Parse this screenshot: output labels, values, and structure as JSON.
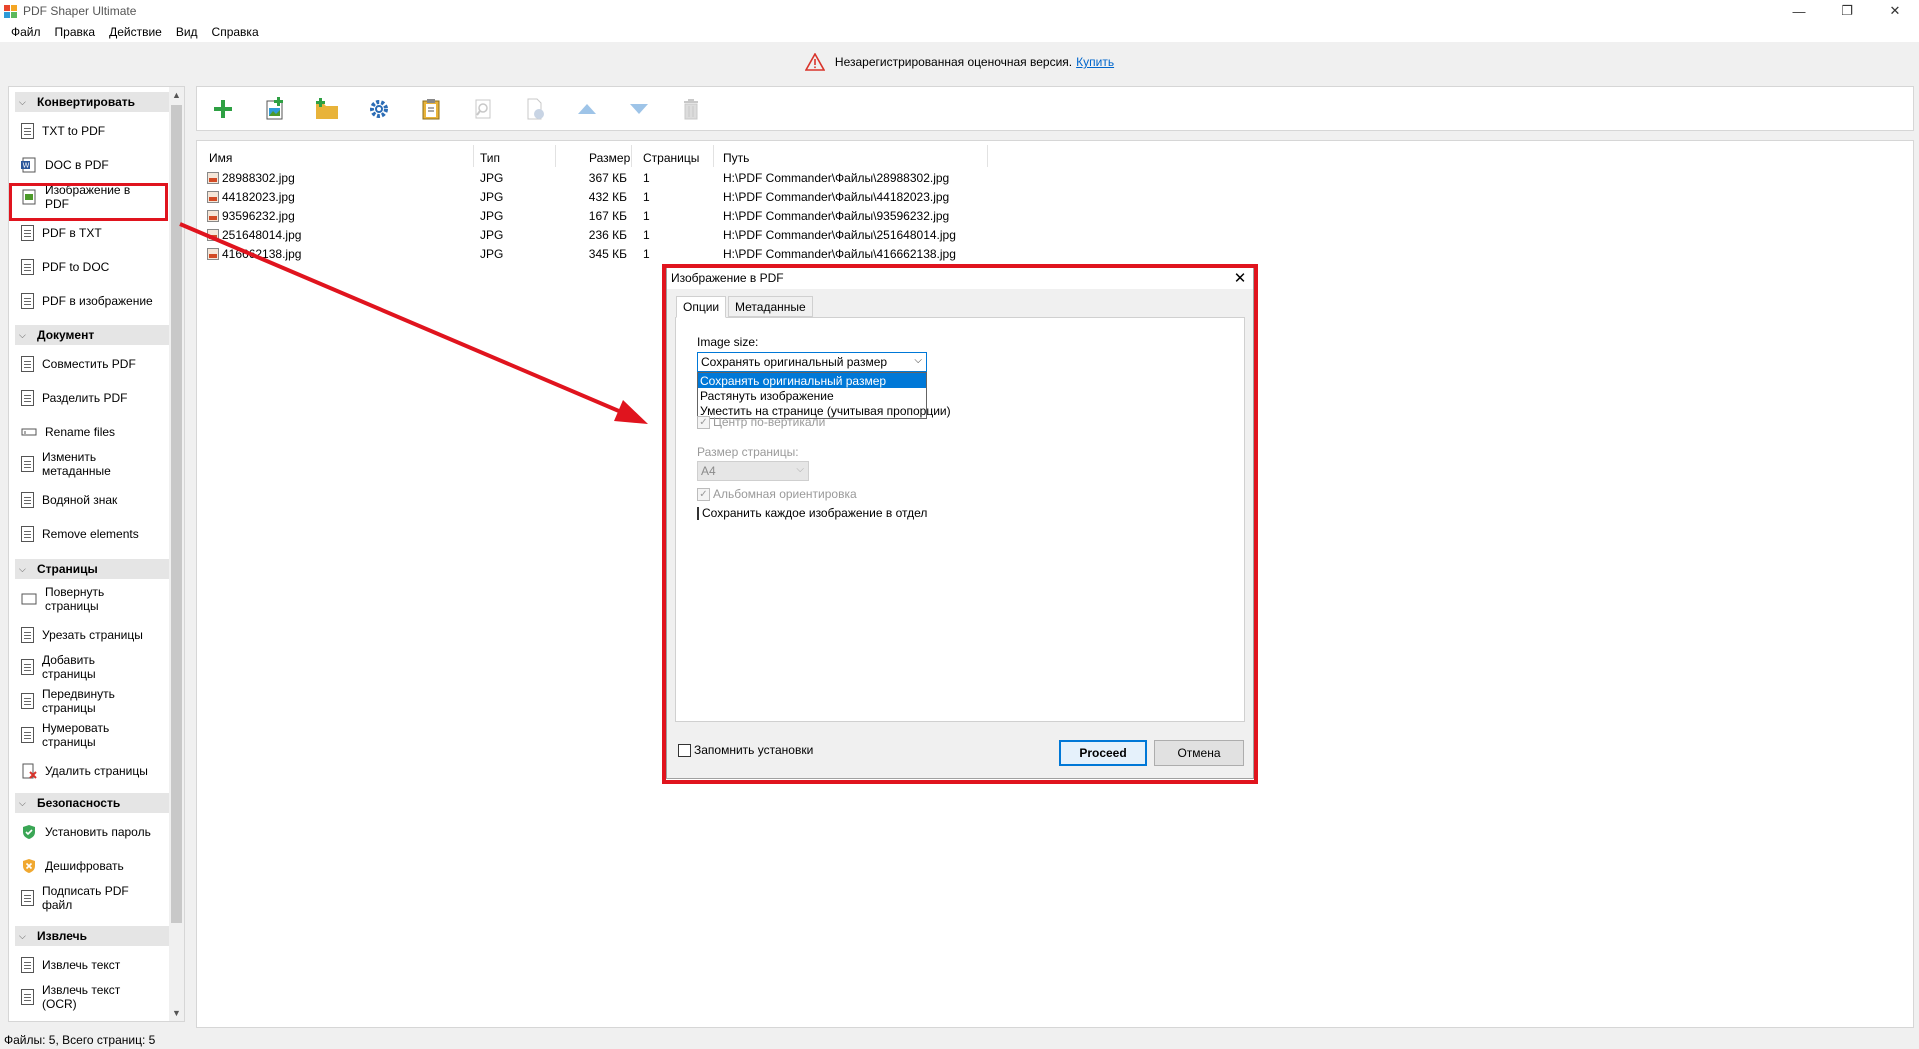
{
  "app": {
    "title": "PDF Shaper Ultimate"
  },
  "window_controls": {
    "minimize": "—",
    "maximize": "❐",
    "close": "✕"
  },
  "menu": [
    "Файл",
    "Правка",
    "Действие",
    "Вид",
    "Справка"
  ],
  "banner": {
    "text": "Незарегистрированная оценочная версия.",
    "link": "Купить"
  },
  "sidebar": {
    "sections": [
      {
        "label": "Конвертировать",
        "items": [
          "TXT to PDF",
          "DOC в PDF",
          "Изображение в PDF",
          "PDF в TXT",
          "PDF to DOC",
          "PDF в изображение"
        ]
      },
      {
        "label": "Документ",
        "items": [
          "Совместить PDF",
          "Разделить PDF",
          "Rename files",
          "Изменить метаданные",
          "Водяной знак",
          "Remove elements"
        ]
      },
      {
        "label": "Страницы",
        "items": [
          "Повернуть страницы",
          "Урезать страницы",
          "Добавить страницы",
          "Передвинуть страницы",
          "Нумеровать страницы",
          "Удалить страницы"
        ]
      },
      {
        "label": "Безопасность",
        "items": [
          "Установить пароль",
          "Дешифровать",
          "Подписать PDF файл"
        ]
      },
      {
        "label": "Извлечь",
        "items": [
          "Извлечь текст",
          "Извлечь текст (OCR)"
        ]
      }
    ]
  },
  "file_table": {
    "columns": [
      "Имя",
      "Тип",
      "Размер",
      "Страницы",
      "Путь"
    ],
    "rows": [
      [
        "28988302.jpg",
        "JPG",
        "367 КБ",
        "1",
        "H:\\PDF Commander\\Файлы\\28988302.jpg"
      ],
      [
        "44182023.jpg",
        "JPG",
        "432 КБ",
        "1",
        "H:\\PDF Commander\\Файлы\\44182023.jpg"
      ],
      [
        "93596232.jpg",
        "JPG",
        "167 КБ",
        "1",
        "H:\\PDF Commander\\Файлы\\93596232.jpg"
      ],
      [
        "251648014.jpg",
        "JPG",
        "236 КБ",
        "1",
        "H:\\PDF Commander\\Файлы\\251648014.jpg"
      ],
      [
        "416662138.jpg",
        "JPG",
        "345 КБ",
        "1",
        "H:\\PDF Commander\\Файлы\\416662138.jpg"
      ]
    ]
  },
  "statusbar": {
    "text": "Файлы: 5, Всего страниц: 5"
  },
  "dialog": {
    "title": "Изображение в PDF",
    "tabs": [
      "Опции",
      "Метаданные"
    ],
    "image_size_label": "Image size:",
    "image_size_value": "Сохранять оригинальный размер",
    "image_size_options": [
      "Сохранять оригинальный размер",
      "Растянуть изображение",
      "Уместить на странице (учитывая пропорции)"
    ],
    "center_vertical": "Центр по-вертикали",
    "page_size_label": "Размер страницы:",
    "page_size_value": "A4",
    "landscape": "Альбомная ориентировка",
    "save_each": "Сохранить каждое изображение в отдельный ф",
    "remember": "Запомнить установки",
    "proceed": "Proceed",
    "cancel": "Отмена"
  },
  "colors": {
    "accent": "#0078d7",
    "highlight": "#e0141e",
    "link": "#0066cc"
  }
}
